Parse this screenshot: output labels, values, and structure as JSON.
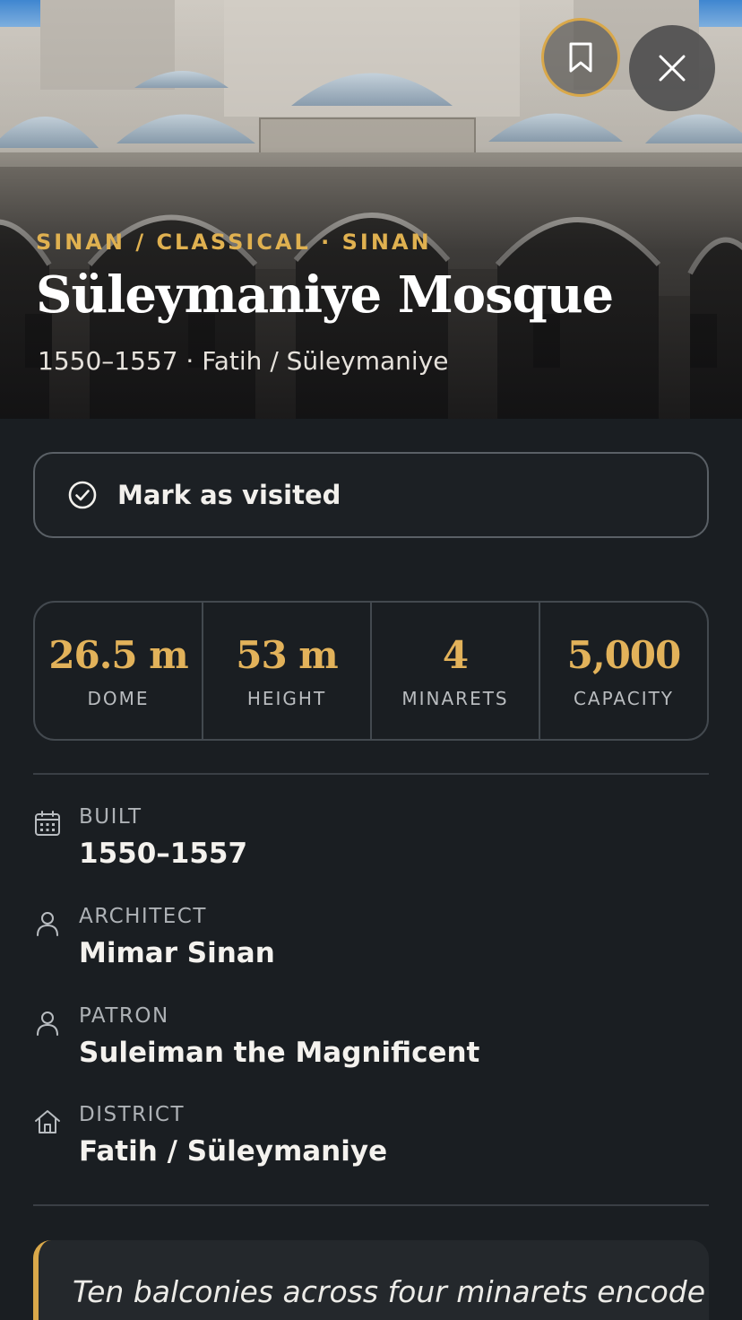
{
  "header": {
    "kicker": "SINAN / CLASSICAL · SINAN",
    "title": "Süleymaniye Mosque",
    "subtitle": "1550–1557 · Fatih / Süleymaniye",
    "bookmark_icon": "bookmark-icon",
    "close_icon": "close-icon"
  },
  "actions": {
    "mark_visited_label": "Mark as visited",
    "mark_visited_icon": "check-circle-icon"
  },
  "stats": [
    {
      "value": "26.5 m",
      "label": "DOME"
    },
    {
      "value": "53 m",
      "label": "HEIGHT"
    },
    {
      "value": "4",
      "label": "MINARETS"
    },
    {
      "value": "5,000",
      "label": "CAPACITY"
    }
  ],
  "facts": [
    {
      "label": "BUILT",
      "value": "1550–1557",
      "icon": "calendar-icon"
    },
    {
      "label": "ARCHITECT",
      "value": "Mimar Sinan",
      "icon": "person-icon"
    },
    {
      "label": "PATRON",
      "value": "Suleiman the Magnificent",
      "icon": "person-icon"
    },
    {
      "label": "DISTRICT",
      "value": "Fatih / Süleymaniye",
      "icon": "home-icon"
    }
  ],
  "quote": {
    "text": "Ten balconies across four minarets encode"
  },
  "colors": {
    "accent": "#e0b150",
    "background": "#1a1e22",
    "border": "#43494f"
  }
}
